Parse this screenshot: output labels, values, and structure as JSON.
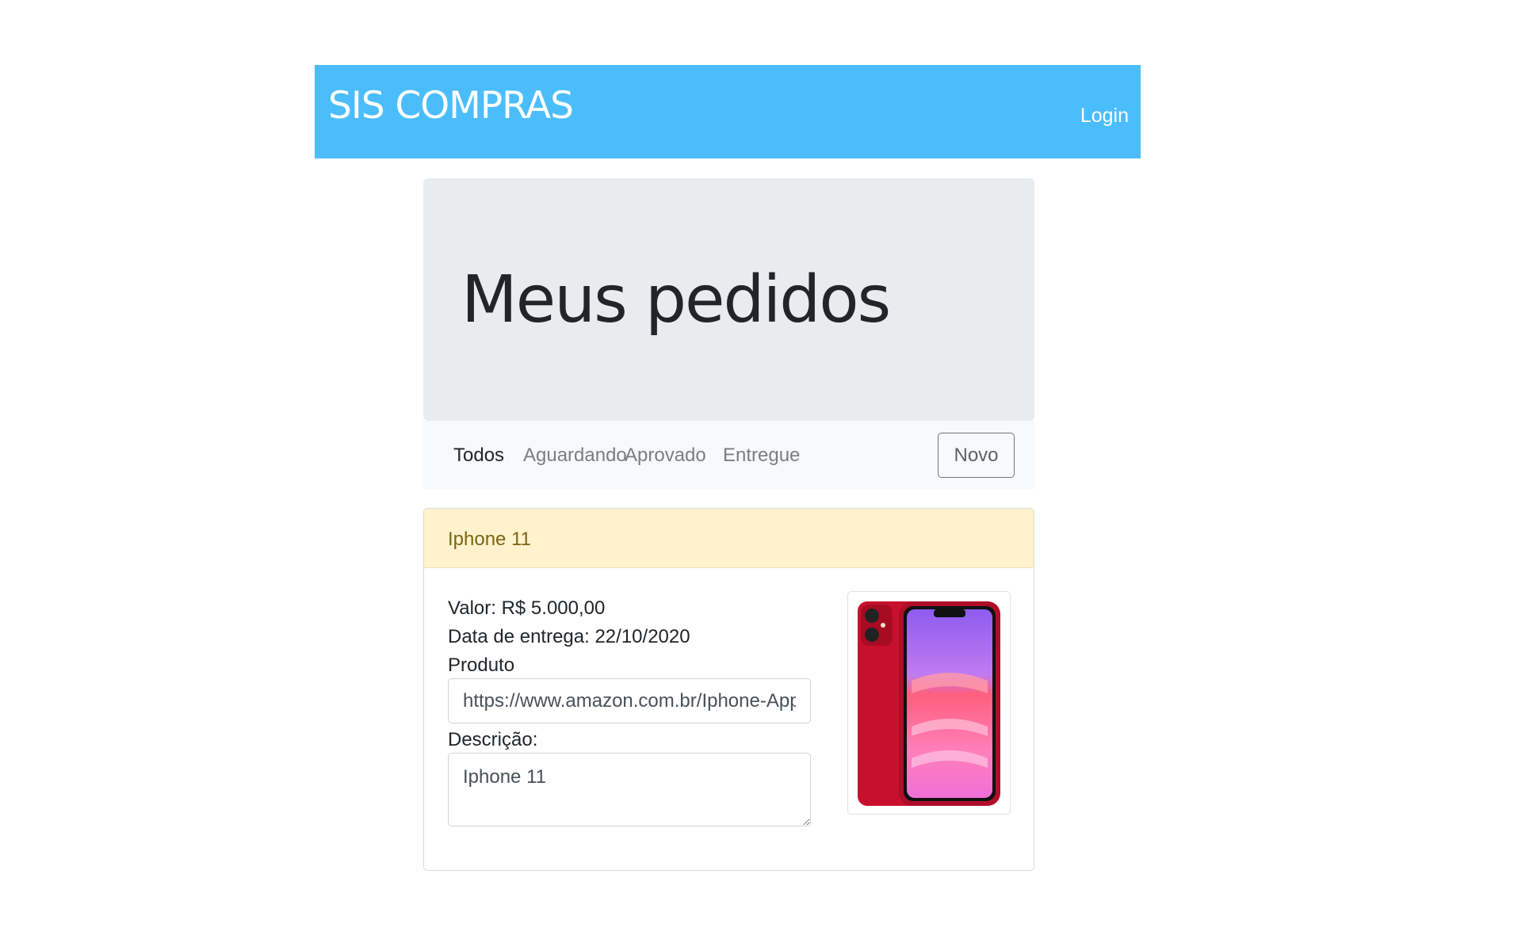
{
  "navbar": {
    "brand": "SIS COMPRAS",
    "login_label": "Login"
  },
  "jumbotron": {
    "title": "Meus pedidos"
  },
  "filters": {
    "items": [
      {
        "label": "Todos",
        "active": true
      },
      {
        "label": "Aguardando",
        "active": false
      },
      {
        "label": "Aprovado",
        "active": false
      },
      {
        "label": "Entregue",
        "active": false
      }
    ],
    "new_button_label": "Novo"
  },
  "order": {
    "title": "Iphone 11",
    "valor": "Valor: R$ 5.000,00",
    "data_entrega": "Data de entrega: 22/10/2020",
    "produto_label": "Produto",
    "produto_url": "https://www.amazon.com.br/Iphone-Apple",
    "descricao_label": "Descrição:",
    "descricao_value": "Iphone 11",
    "image_icon": "iphone-image"
  },
  "colors": {
    "navbar": "#4bbdfc",
    "jumbotron": "#e9ecef",
    "card_header": "#fff2cc",
    "phone_body": "#c8102e"
  }
}
